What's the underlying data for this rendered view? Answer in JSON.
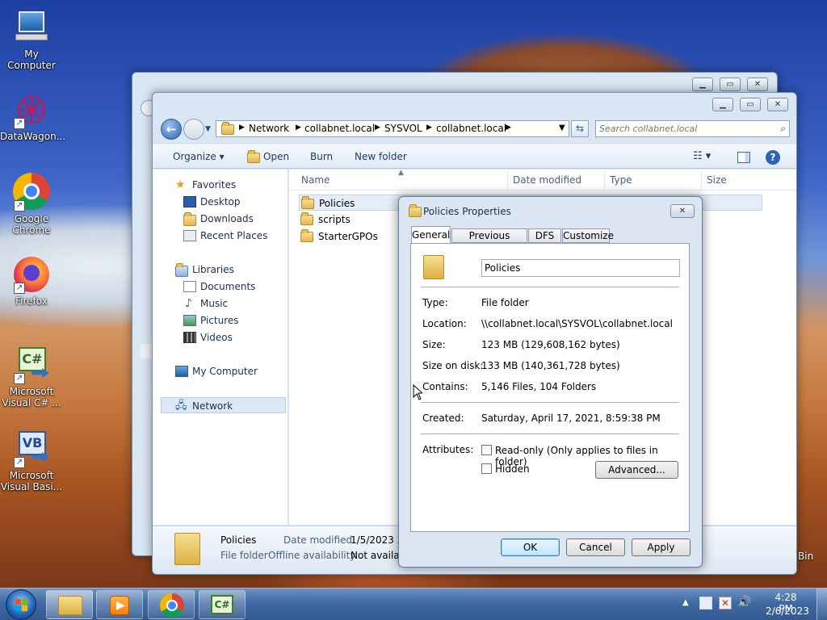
{
  "desktop": {
    "icons": [
      {
        "label": "My Computer"
      },
      {
        "label": "DataWagon..."
      },
      {
        "label": "Google Chrome"
      },
      {
        "label": "Firefox"
      },
      {
        "label": "Microsoft Visual C# ..."
      },
      {
        "label": "Microsoft Visual Basi..."
      }
    ],
    "recycle_label": "Bin"
  },
  "explorer": {
    "breadcrumb": [
      "Network",
      "collabnet.local",
      "SYSVOL",
      "collabnet.local"
    ],
    "search_placeholder": "Search collabnet.local",
    "toolbar": {
      "organize": "Organize",
      "open": "Open",
      "burn": "Burn",
      "new_folder": "New folder"
    },
    "nav": {
      "favorites": "Favorites",
      "desktop": "Desktop",
      "downloads": "Downloads",
      "recent": "Recent Places",
      "libraries": "Libraries",
      "documents": "Documents",
      "music": "Music",
      "pictures": "Pictures",
      "videos": "Videos",
      "my_computer": "My Computer",
      "network": "Network"
    },
    "columns": {
      "name": "Name",
      "date": "Date modified",
      "type": "Type",
      "size": "Size"
    },
    "files": [
      "Policies",
      "scripts",
      "StarterGPOs"
    ],
    "details": {
      "name": "Policies",
      "type": "File folder",
      "date_label": "Date modified:",
      "date_value": "1/5/2023 2:",
      "offline_label": "Offline availability:",
      "offline_value": "Not availab"
    }
  },
  "dialog": {
    "title": "Policies Properties",
    "tabs": [
      "General",
      "Previous Versions",
      "DFS",
      "Customize"
    ],
    "name_value": "Policies",
    "rows": [
      {
        "label": "Type:",
        "value": "File folder"
      },
      {
        "label": "Location:",
        "value": "\\\\collabnet.local\\SYSVOL\\collabnet.local"
      },
      {
        "label": "Size:",
        "value": "123 MB (129,608,162 bytes)"
      },
      {
        "label": "Size on disk:",
        "value": "133 MB (140,361,728 bytes)"
      },
      {
        "label": "Contains:",
        "value": "5,146 Files, 104 Folders"
      }
    ],
    "created_label": "Created:",
    "created_value": "Saturday, April 17, 2021, 8:59:38 PM",
    "attributes_label": "Attributes:",
    "readonly": "Read-only (Only applies to files in folder)",
    "hidden": "Hidden",
    "advanced": "Advanced...",
    "ok": "OK",
    "cancel": "Cancel",
    "apply": "Apply"
  },
  "taskbar": {
    "time": "4:28 PM",
    "date": "2/6/2023"
  },
  "colors": {
    "accent": "#2962b8",
    "taskbar": "#3f6aa3",
    "selection": "#cce8ff"
  }
}
